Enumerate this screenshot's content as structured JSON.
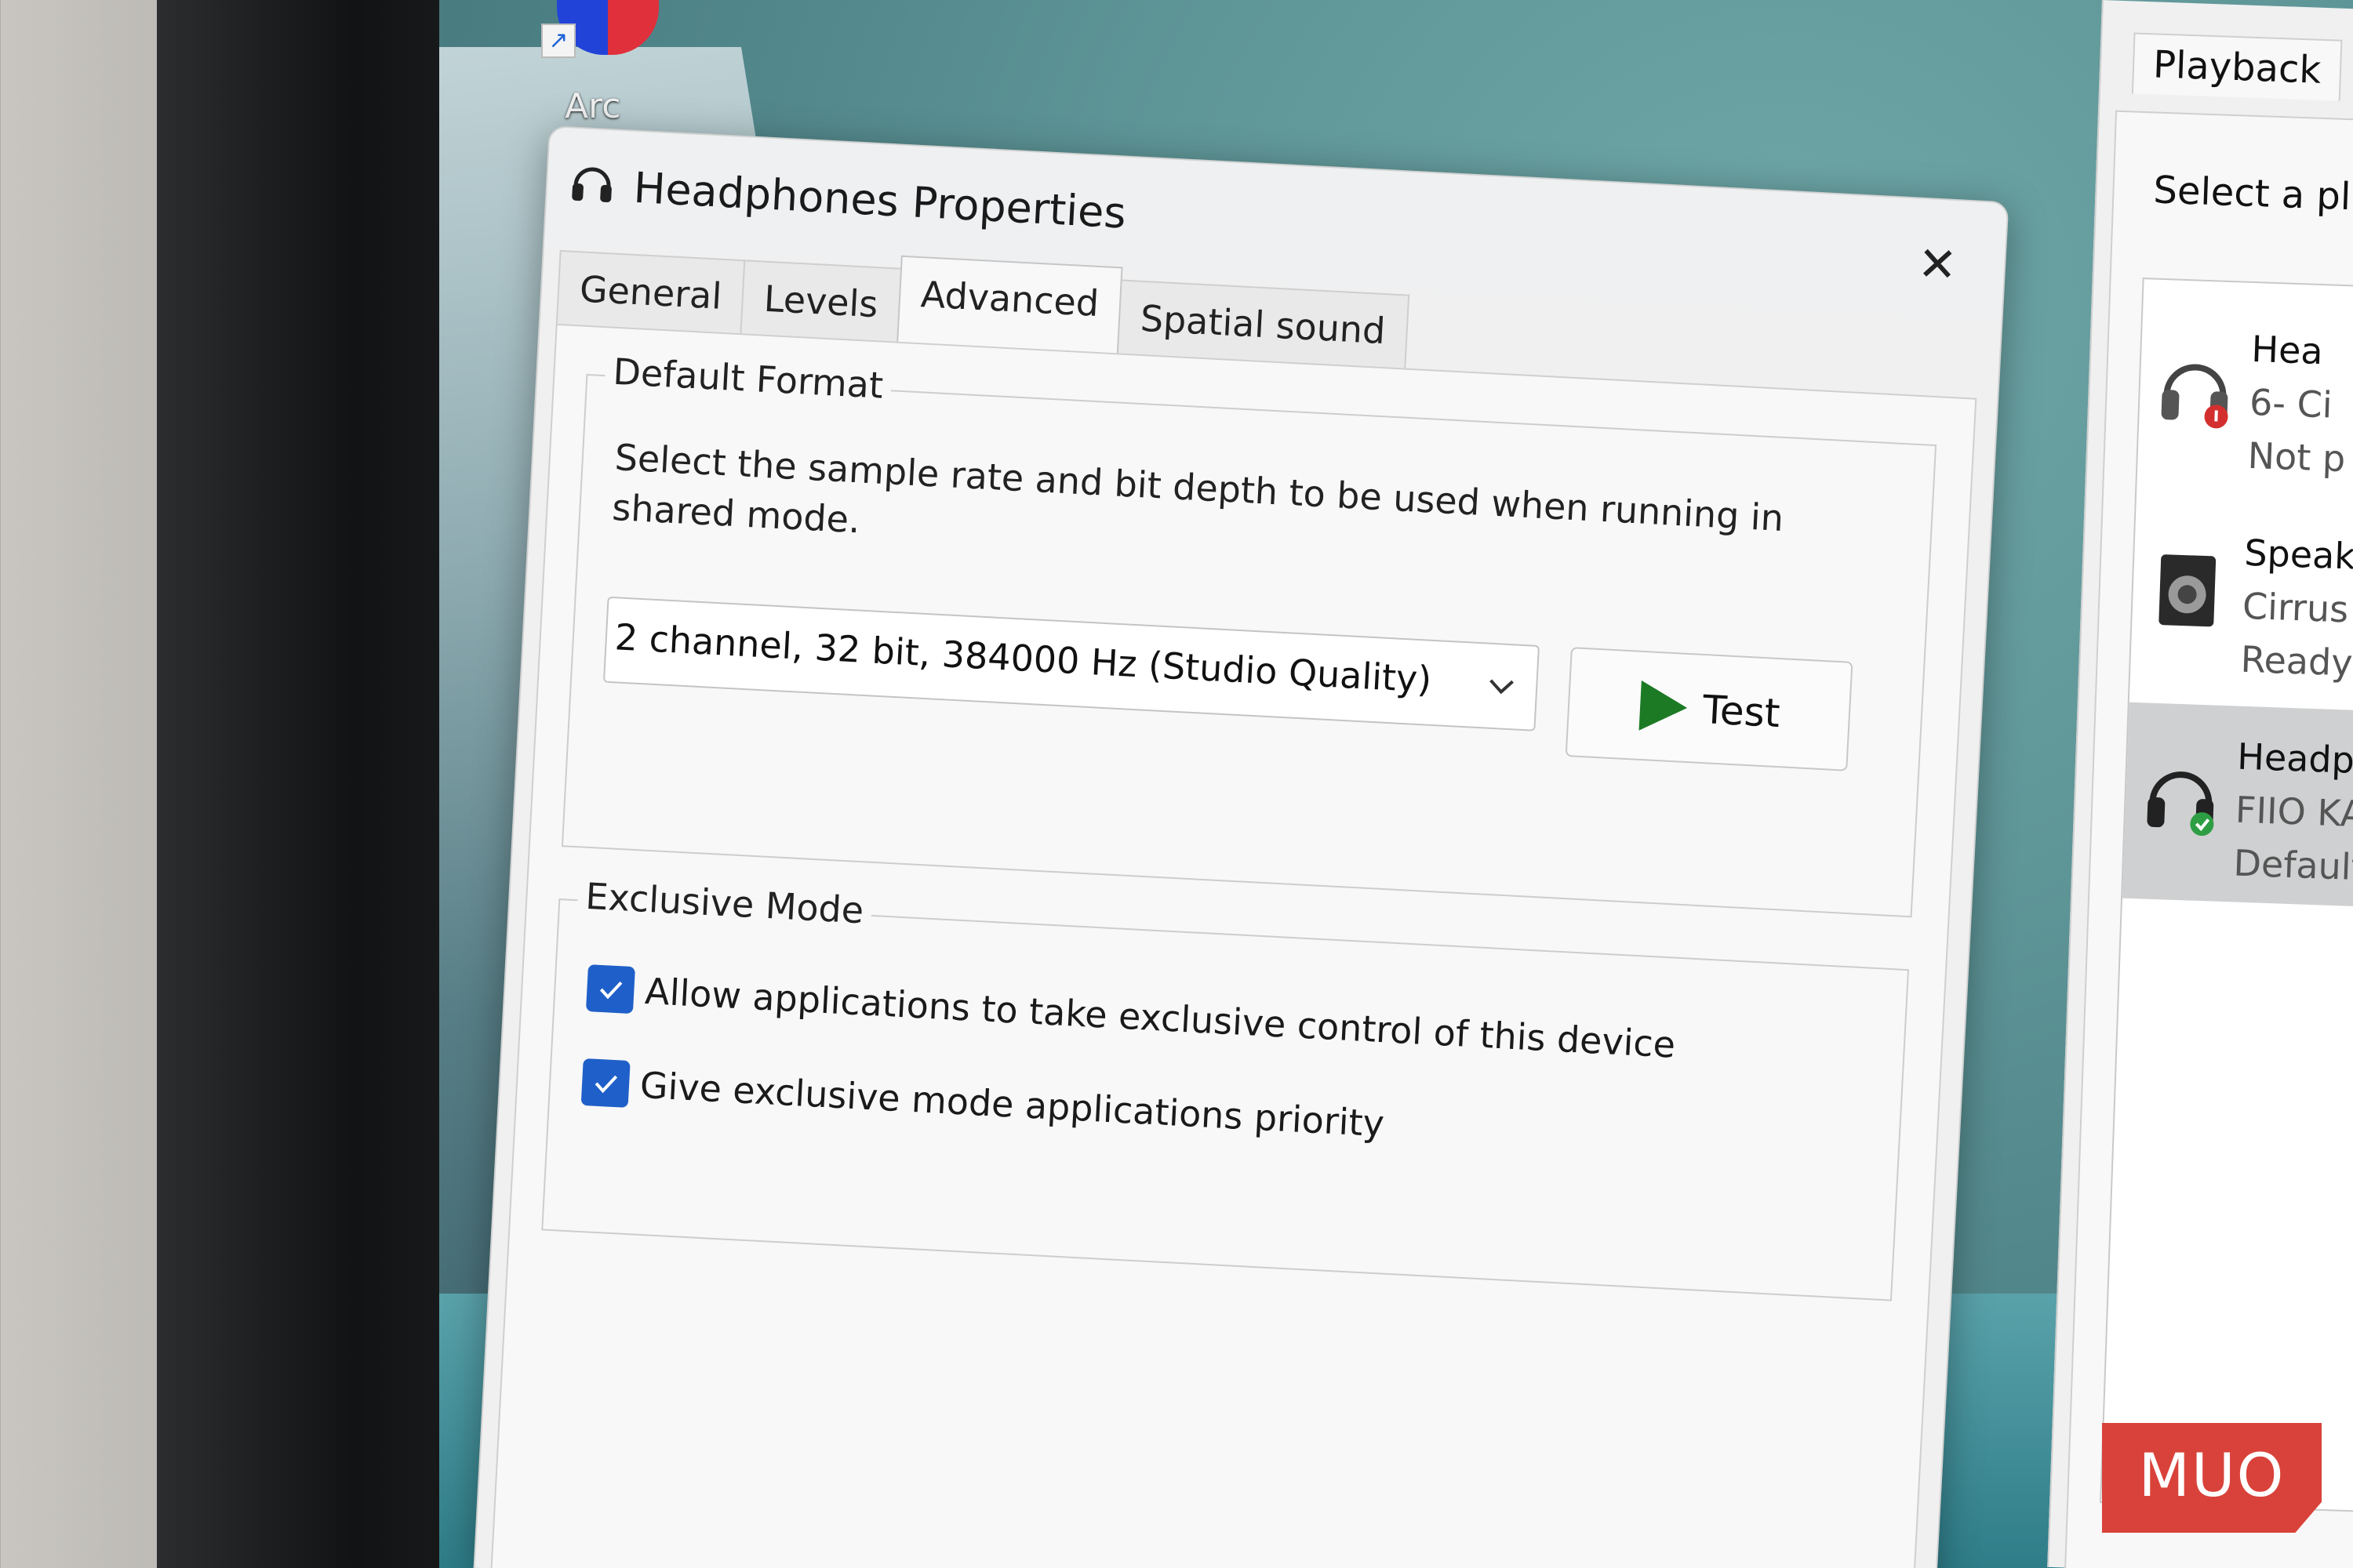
{
  "desktop": {
    "icon_label": "Arc"
  },
  "dialog": {
    "title": "Headphones Properties",
    "close_glyph": "✕",
    "tabs": [
      {
        "label": "General"
      },
      {
        "label": "Levels"
      },
      {
        "label": "Advanced"
      },
      {
        "label": "Spatial sound"
      }
    ],
    "active_tab": "Advanced",
    "default_format": {
      "legend": "Default Format",
      "description": "Select the sample rate and bit depth to be used when running in shared mode.",
      "selected_format": "2 channel, 32 bit, 384000 Hz (Studio Quality)",
      "test_label": "Test"
    },
    "exclusive_mode": {
      "legend": "Exclusive Mode",
      "options": [
        {
          "label": "Allow applications to take exclusive control of this device",
          "checked": true
        },
        {
          "label": "Give exclusive mode applications priority",
          "checked": true
        }
      ]
    }
  },
  "sound_dialog": {
    "tab_label": "Playback",
    "instruction": "Select a pl",
    "devices": [
      {
        "name": "Hea",
        "line2": "6- Ci",
        "line3": "Not p",
        "status_icon": "disconnected-icon",
        "selected": false
      },
      {
        "name": "Speak",
        "line2": "Cirrus",
        "line3": "Ready",
        "status_icon": "",
        "selected": false
      },
      {
        "name": "Headph",
        "line2": "FIIO KA",
        "line3": "Default",
        "status_icon": "default-check-icon",
        "selected": true
      }
    ]
  },
  "watermark": {
    "text": "MUO"
  },
  "colors": {
    "checkbox": "#1f5fc9",
    "play": "#1c7a24",
    "watermark": "#d9423a"
  }
}
